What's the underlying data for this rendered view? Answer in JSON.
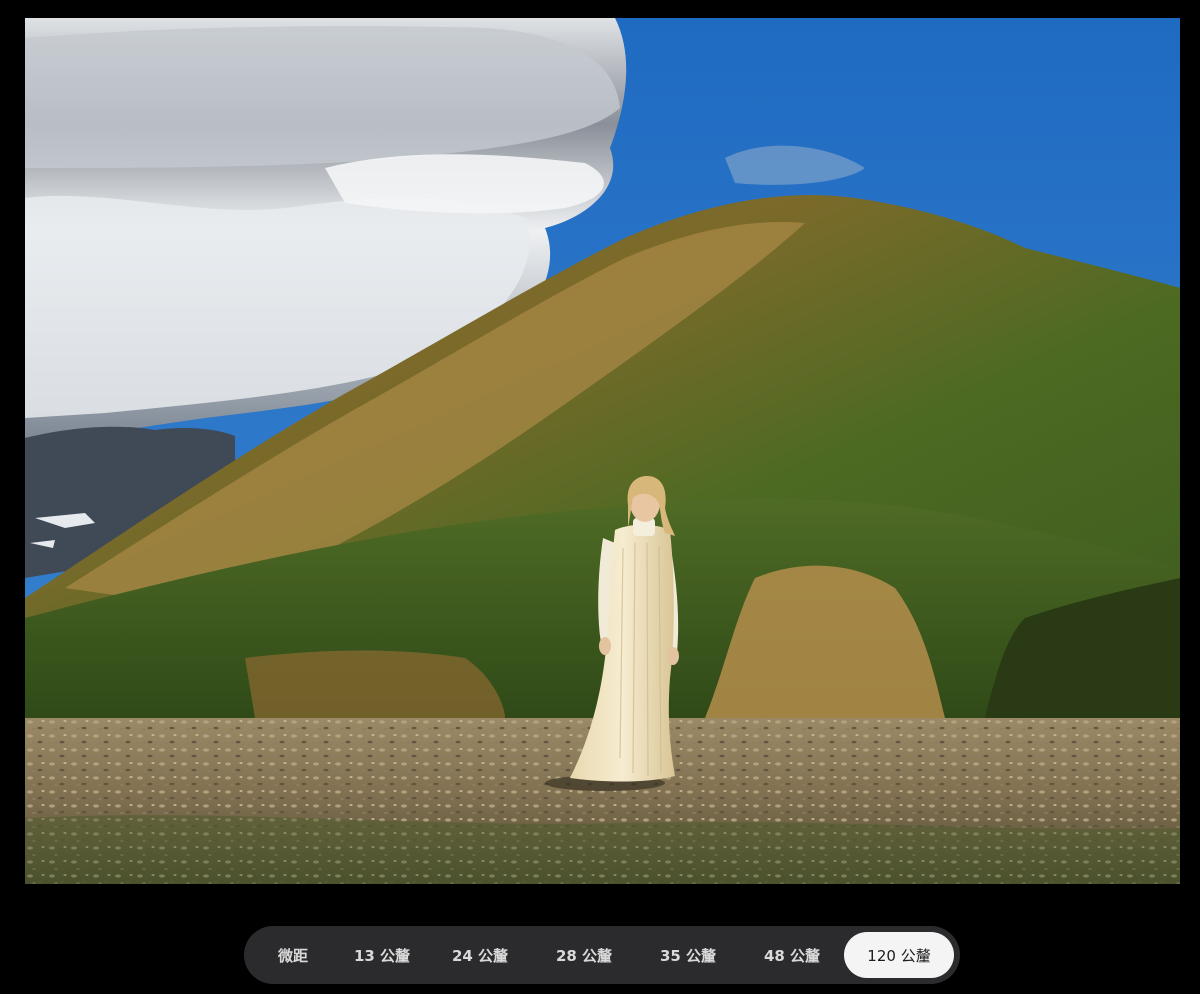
{
  "photo": {
    "subject": "Woman in cream dress standing on rocky plain before a green and ochre mountain under blue sky with clouds"
  },
  "lens_selector": {
    "options": [
      {
        "label": "微距"
      },
      {
        "label": "13 公釐"
      },
      {
        "label": "24 公釐"
      },
      {
        "label": "28 公釐"
      },
      {
        "label": "35 公釐"
      },
      {
        "label": "48 公釐"
      },
      {
        "label": "120 公釐"
      }
    ],
    "selected_index": 6
  },
  "colors": {
    "background": "#000000",
    "bar_background": "#2b2b2d",
    "bar_text": "#d9d9d9",
    "selected_pill": "#f4f4f4",
    "selected_text": "#1d1d1f",
    "sky": "#2d73c4"
  }
}
